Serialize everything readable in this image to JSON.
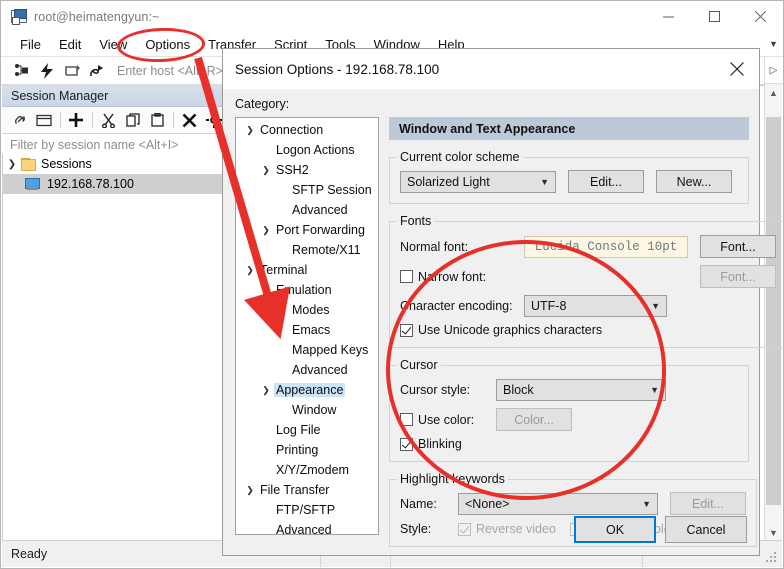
{
  "window": {
    "title": "root@heimatengyun:~",
    "icon": "securecrt-icon",
    "minimize": "minimize-icon",
    "maximize": "maximize-icon",
    "close": "close-icon"
  },
  "menubar": {
    "items": [
      "File",
      "Edit",
      "View",
      "Options",
      "Transfer",
      "Script",
      "Tools",
      "Window",
      "Help"
    ]
  },
  "toolbar": {
    "icons": [
      "connect-icon",
      "quick-connect-icon",
      "reconnect-icon",
      "connect-sftp-icon"
    ],
    "host_placeholder": "Enter host <Alt+R>"
  },
  "session_manager": {
    "header": "Session Manager",
    "toolbar_icons": [
      "link-icon",
      "new-tab-icon",
      "add-icon",
      "cut-icon",
      "copy-icon",
      "paste-icon",
      "delete-icon",
      "properties-icon"
    ],
    "filter_placeholder": "Filter by session name <Alt+I>",
    "tree": [
      {
        "label": "Sessions",
        "icon": "folder-icon",
        "expanded": true,
        "level": 0,
        "selected": false
      },
      {
        "label": "192.168.78.100",
        "icon": "host-icon",
        "expanded": false,
        "level": 1,
        "selected": true
      }
    ]
  },
  "statusbar": {
    "text": "Ready"
  },
  "dialog": {
    "title": "Session Options - 192.168.78.100",
    "close": "close-icon",
    "category_label": "Category:",
    "categories": [
      {
        "label": "Connection",
        "indent": 0,
        "chevron": "v",
        "selected": false
      },
      {
        "label": "Logon Actions",
        "indent": 1,
        "chevron": "",
        "selected": false
      },
      {
        "label": "SSH2",
        "indent": 1,
        "chevron": "v",
        "selected": false
      },
      {
        "label": "SFTP Session",
        "indent": 2,
        "chevron": "",
        "selected": false
      },
      {
        "label": "Advanced",
        "indent": 2,
        "chevron": "",
        "selected": false
      },
      {
        "label": "Port Forwarding",
        "indent": 1,
        "chevron": "v",
        "selected": false
      },
      {
        "label": "Remote/X11",
        "indent": 2,
        "chevron": "",
        "selected": false
      },
      {
        "label": "Terminal",
        "indent": 0,
        "chevron": "v",
        "selected": false
      },
      {
        "label": "Emulation",
        "indent": 1,
        "chevron": "v",
        "selected": false
      },
      {
        "label": "Modes",
        "indent": 2,
        "chevron": "",
        "selected": false
      },
      {
        "label": "Emacs",
        "indent": 2,
        "chevron": "",
        "selected": false
      },
      {
        "label": "Mapped Keys",
        "indent": 2,
        "chevron": "",
        "selected": false
      },
      {
        "label": "Advanced",
        "indent": 2,
        "chevron": "",
        "selected": false
      },
      {
        "label": "Appearance",
        "indent": 1,
        "chevron": "v",
        "selected": true
      },
      {
        "label": "Window",
        "indent": 2,
        "chevron": "",
        "selected": false
      },
      {
        "label": "Log File",
        "indent": 1,
        "chevron": "",
        "selected": false
      },
      {
        "label": "Printing",
        "indent": 1,
        "chevron": "",
        "selected": false
      },
      {
        "label": "X/Y/Zmodem",
        "indent": 1,
        "chevron": "",
        "selected": false
      },
      {
        "label": "File Transfer",
        "indent": 0,
        "chevron": "v",
        "selected": false
      },
      {
        "label": "FTP/SFTP",
        "indent": 1,
        "chevron": "",
        "selected": false
      },
      {
        "label": "Advanced",
        "indent": 1,
        "chevron": "",
        "selected": false
      }
    ],
    "pane_title": "Window and Text Appearance",
    "color_scheme": {
      "legend": "Current color scheme",
      "value": "Solarized Light",
      "edit_button": "Edit...",
      "new_button": "New..."
    },
    "fonts": {
      "legend": "Fonts",
      "normal_font_label": "Normal font:",
      "normal_font_value": "Lucida Console 10pt",
      "normal_font_button": "Font...",
      "narrow_font_label": "Narrow font:",
      "narrow_font_checked": false,
      "narrow_font_button": "Font...",
      "encoding_label": "Character encoding:",
      "encoding_value": "UTF-8",
      "unicode_graphics_label": "Use Unicode graphics characters",
      "unicode_graphics_checked": true
    },
    "cursor": {
      "legend": "Cursor",
      "style_label": "Cursor style:",
      "style_value": "Block",
      "use_color_label": "Use color:",
      "use_color_checked": false,
      "color_button": "Color...",
      "blinking_label": "Blinking",
      "blinking_checked": true
    },
    "highlight": {
      "legend": "Highlight keywords",
      "name_label": "Name:",
      "name_value": "<None>",
      "edit_button": "Edit...",
      "style_label": "Style:",
      "reverse_video_label": "Reverse video",
      "reverse_video_checked": true,
      "bold_label": "Bold",
      "bold_checked": false,
      "color_label": "Color",
      "color_checked": false
    },
    "ok_button": "OK",
    "cancel_button": "Cancel"
  },
  "annotations": {
    "accent_color": "#e8302b",
    "shapes": [
      "ellipse-around-options-menu",
      "arrow-to-appearance-category",
      "ellipse-around-cursor-settings"
    ]
  }
}
